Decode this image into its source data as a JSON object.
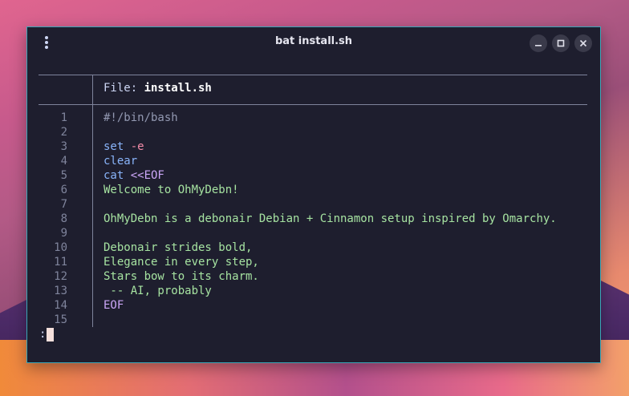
{
  "window": {
    "title": "bat install.sh",
    "buttons": {
      "minimize": "–",
      "maximize": "□",
      "close": "×"
    }
  },
  "header": {
    "label": "File: ",
    "filename": "install.sh"
  },
  "lines": [
    {
      "n": "1",
      "parts": [
        {
          "t": "#!/bin/bash",
          "c": "c-shebang"
        }
      ]
    },
    {
      "n": "2",
      "parts": []
    },
    {
      "n": "3",
      "parts": [
        {
          "t": "set ",
          "c": "c-kw"
        },
        {
          "t": "-e",
          "c": "c-flag"
        }
      ]
    },
    {
      "n": "4",
      "parts": [
        {
          "t": "clear",
          "c": "c-kw"
        }
      ]
    },
    {
      "n": "5",
      "parts": [
        {
          "t": "cat ",
          "c": "c-kw"
        },
        {
          "t": "<<EOF",
          "c": "c-op"
        }
      ]
    },
    {
      "n": "6",
      "parts": [
        {
          "t": "Welcome to OhMyDebn!",
          "c": "c-str"
        }
      ]
    },
    {
      "n": "7",
      "parts": []
    },
    {
      "n": "8",
      "parts": [
        {
          "t": "OhMyDebn is a debonair Debian + Cinnamon setup inspired by Omarchy.",
          "c": "c-str"
        }
      ]
    },
    {
      "n": "9",
      "parts": []
    },
    {
      "n": "10",
      "parts": [
        {
          "t": "Debonair strides bold,",
          "c": "c-str"
        }
      ]
    },
    {
      "n": "11",
      "parts": [
        {
          "t": "Elegance in every step,",
          "c": "c-str"
        }
      ]
    },
    {
      "n": "12",
      "parts": [
        {
          "t": "Stars bow to its charm.",
          "c": "c-str"
        }
      ]
    },
    {
      "n": "13",
      "parts": [
        {
          "t": " -- AI, probably",
          "c": "c-str"
        }
      ]
    },
    {
      "n": "14",
      "parts": [
        {
          "t": "EOF",
          "c": "c-op"
        }
      ]
    },
    {
      "n": "15",
      "parts": []
    }
  ],
  "prompt": ":",
  "colors": {
    "accent_border": "#3aa7b8",
    "background": "#1e1e2e",
    "keyword": "#89b4fa",
    "string": "#a6e3a1",
    "operator": "#cba6f7",
    "flag": "#f38ba8"
  }
}
